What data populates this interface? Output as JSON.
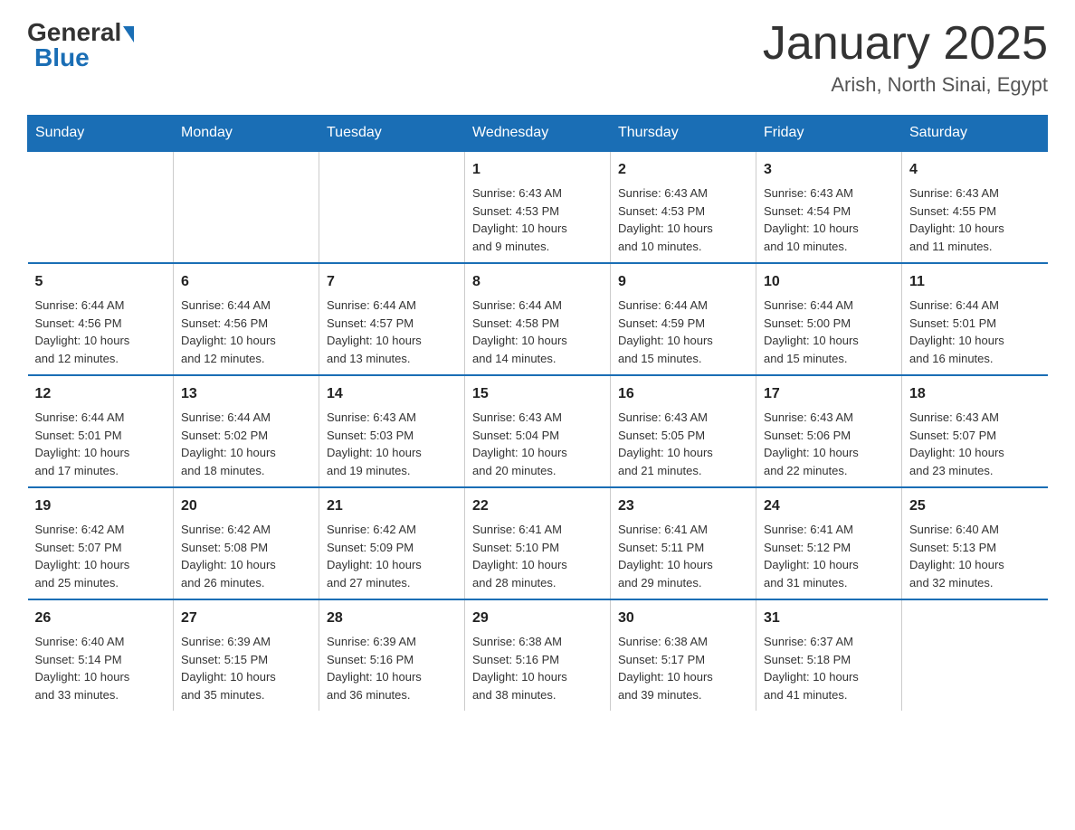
{
  "header": {
    "logo_general": "General",
    "logo_blue": "Blue",
    "title": "January 2025",
    "location": "Arish, North Sinai, Egypt"
  },
  "days_of_week": [
    "Sunday",
    "Monday",
    "Tuesday",
    "Wednesday",
    "Thursday",
    "Friday",
    "Saturday"
  ],
  "weeks": [
    [
      {
        "day": "",
        "info": ""
      },
      {
        "day": "",
        "info": ""
      },
      {
        "day": "",
        "info": ""
      },
      {
        "day": "1",
        "info": "Sunrise: 6:43 AM\nSunset: 4:53 PM\nDaylight: 10 hours\nand 9 minutes."
      },
      {
        "day": "2",
        "info": "Sunrise: 6:43 AM\nSunset: 4:53 PM\nDaylight: 10 hours\nand 10 minutes."
      },
      {
        "day": "3",
        "info": "Sunrise: 6:43 AM\nSunset: 4:54 PM\nDaylight: 10 hours\nand 10 minutes."
      },
      {
        "day": "4",
        "info": "Sunrise: 6:43 AM\nSunset: 4:55 PM\nDaylight: 10 hours\nand 11 minutes."
      }
    ],
    [
      {
        "day": "5",
        "info": "Sunrise: 6:44 AM\nSunset: 4:56 PM\nDaylight: 10 hours\nand 12 minutes."
      },
      {
        "day": "6",
        "info": "Sunrise: 6:44 AM\nSunset: 4:56 PM\nDaylight: 10 hours\nand 12 minutes."
      },
      {
        "day": "7",
        "info": "Sunrise: 6:44 AM\nSunset: 4:57 PM\nDaylight: 10 hours\nand 13 minutes."
      },
      {
        "day": "8",
        "info": "Sunrise: 6:44 AM\nSunset: 4:58 PM\nDaylight: 10 hours\nand 14 minutes."
      },
      {
        "day": "9",
        "info": "Sunrise: 6:44 AM\nSunset: 4:59 PM\nDaylight: 10 hours\nand 15 minutes."
      },
      {
        "day": "10",
        "info": "Sunrise: 6:44 AM\nSunset: 5:00 PM\nDaylight: 10 hours\nand 15 minutes."
      },
      {
        "day": "11",
        "info": "Sunrise: 6:44 AM\nSunset: 5:01 PM\nDaylight: 10 hours\nand 16 minutes."
      }
    ],
    [
      {
        "day": "12",
        "info": "Sunrise: 6:44 AM\nSunset: 5:01 PM\nDaylight: 10 hours\nand 17 minutes."
      },
      {
        "day": "13",
        "info": "Sunrise: 6:44 AM\nSunset: 5:02 PM\nDaylight: 10 hours\nand 18 minutes."
      },
      {
        "day": "14",
        "info": "Sunrise: 6:43 AM\nSunset: 5:03 PM\nDaylight: 10 hours\nand 19 minutes."
      },
      {
        "day": "15",
        "info": "Sunrise: 6:43 AM\nSunset: 5:04 PM\nDaylight: 10 hours\nand 20 minutes."
      },
      {
        "day": "16",
        "info": "Sunrise: 6:43 AM\nSunset: 5:05 PM\nDaylight: 10 hours\nand 21 minutes."
      },
      {
        "day": "17",
        "info": "Sunrise: 6:43 AM\nSunset: 5:06 PM\nDaylight: 10 hours\nand 22 minutes."
      },
      {
        "day": "18",
        "info": "Sunrise: 6:43 AM\nSunset: 5:07 PM\nDaylight: 10 hours\nand 23 minutes."
      }
    ],
    [
      {
        "day": "19",
        "info": "Sunrise: 6:42 AM\nSunset: 5:07 PM\nDaylight: 10 hours\nand 25 minutes."
      },
      {
        "day": "20",
        "info": "Sunrise: 6:42 AM\nSunset: 5:08 PM\nDaylight: 10 hours\nand 26 minutes."
      },
      {
        "day": "21",
        "info": "Sunrise: 6:42 AM\nSunset: 5:09 PM\nDaylight: 10 hours\nand 27 minutes."
      },
      {
        "day": "22",
        "info": "Sunrise: 6:41 AM\nSunset: 5:10 PM\nDaylight: 10 hours\nand 28 minutes."
      },
      {
        "day": "23",
        "info": "Sunrise: 6:41 AM\nSunset: 5:11 PM\nDaylight: 10 hours\nand 29 minutes."
      },
      {
        "day": "24",
        "info": "Sunrise: 6:41 AM\nSunset: 5:12 PM\nDaylight: 10 hours\nand 31 minutes."
      },
      {
        "day": "25",
        "info": "Sunrise: 6:40 AM\nSunset: 5:13 PM\nDaylight: 10 hours\nand 32 minutes."
      }
    ],
    [
      {
        "day": "26",
        "info": "Sunrise: 6:40 AM\nSunset: 5:14 PM\nDaylight: 10 hours\nand 33 minutes."
      },
      {
        "day": "27",
        "info": "Sunrise: 6:39 AM\nSunset: 5:15 PM\nDaylight: 10 hours\nand 35 minutes."
      },
      {
        "day": "28",
        "info": "Sunrise: 6:39 AM\nSunset: 5:16 PM\nDaylight: 10 hours\nand 36 minutes."
      },
      {
        "day": "29",
        "info": "Sunrise: 6:38 AM\nSunset: 5:16 PM\nDaylight: 10 hours\nand 38 minutes."
      },
      {
        "day": "30",
        "info": "Sunrise: 6:38 AM\nSunset: 5:17 PM\nDaylight: 10 hours\nand 39 minutes."
      },
      {
        "day": "31",
        "info": "Sunrise: 6:37 AM\nSunset: 5:18 PM\nDaylight: 10 hours\nand 41 minutes."
      },
      {
        "day": "",
        "info": ""
      }
    ]
  ]
}
